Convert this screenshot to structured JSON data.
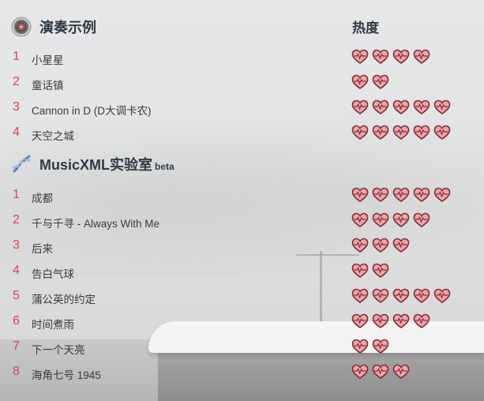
{
  "heat_header": "热度",
  "sections": [
    {
      "id": "yanzou",
      "title": "演奏示例",
      "beta": "",
      "icon": "vinyl-record-icon",
      "rows": [
        {
          "num": "1",
          "name": "小星星",
          "heat": 4
        },
        {
          "num": "2",
          "name": "童话镇",
          "heat": 2
        },
        {
          "num": "3",
          "name": "Cannon in D (D大调卡农)",
          "heat": 5
        },
        {
          "num": "4",
          "name": "天空之城",
          "heat": 5
        }
      ]
    },
    {
      "id": "musicxml",
      "title": "MusicXML实验室",
      "beta": "beta",
      "icon": "dna-helix-icon",
      "rows": [
        {
          "num": "1",
          "name": "成都",
          "heat": 5
        },
        {
          "num": "2",
          "name": "千与千寻 - Always With Me",
          "heat": 4
        },
        {
          "num": "3",
          "name": "后来",
          "heat": 3
        },
        {
          "num": "4",
          "name": "告白气球",
          "heat": 2
        },
        {
          "num": "5",
          "name": "蒲公英的约定",
          "heat": 5
        },
        {
          "num": "6",
          "name": "时间煮雨",
          "heat": 4
        },
        {
          "num": "7",
          "name": "下一个天亮",
          "heat": 2
        },
        {
          "num": "8",
          "name": "海角七号 1945",
          "heat": 3
        }
      ]
    }
  ],
  "colors": {
    "number": "#e0404e",
    "heart_fill": "#f4a3a8",
    "heart_stroke": "#7a2f36",
    "title": "#2f3a46"
  }
}
